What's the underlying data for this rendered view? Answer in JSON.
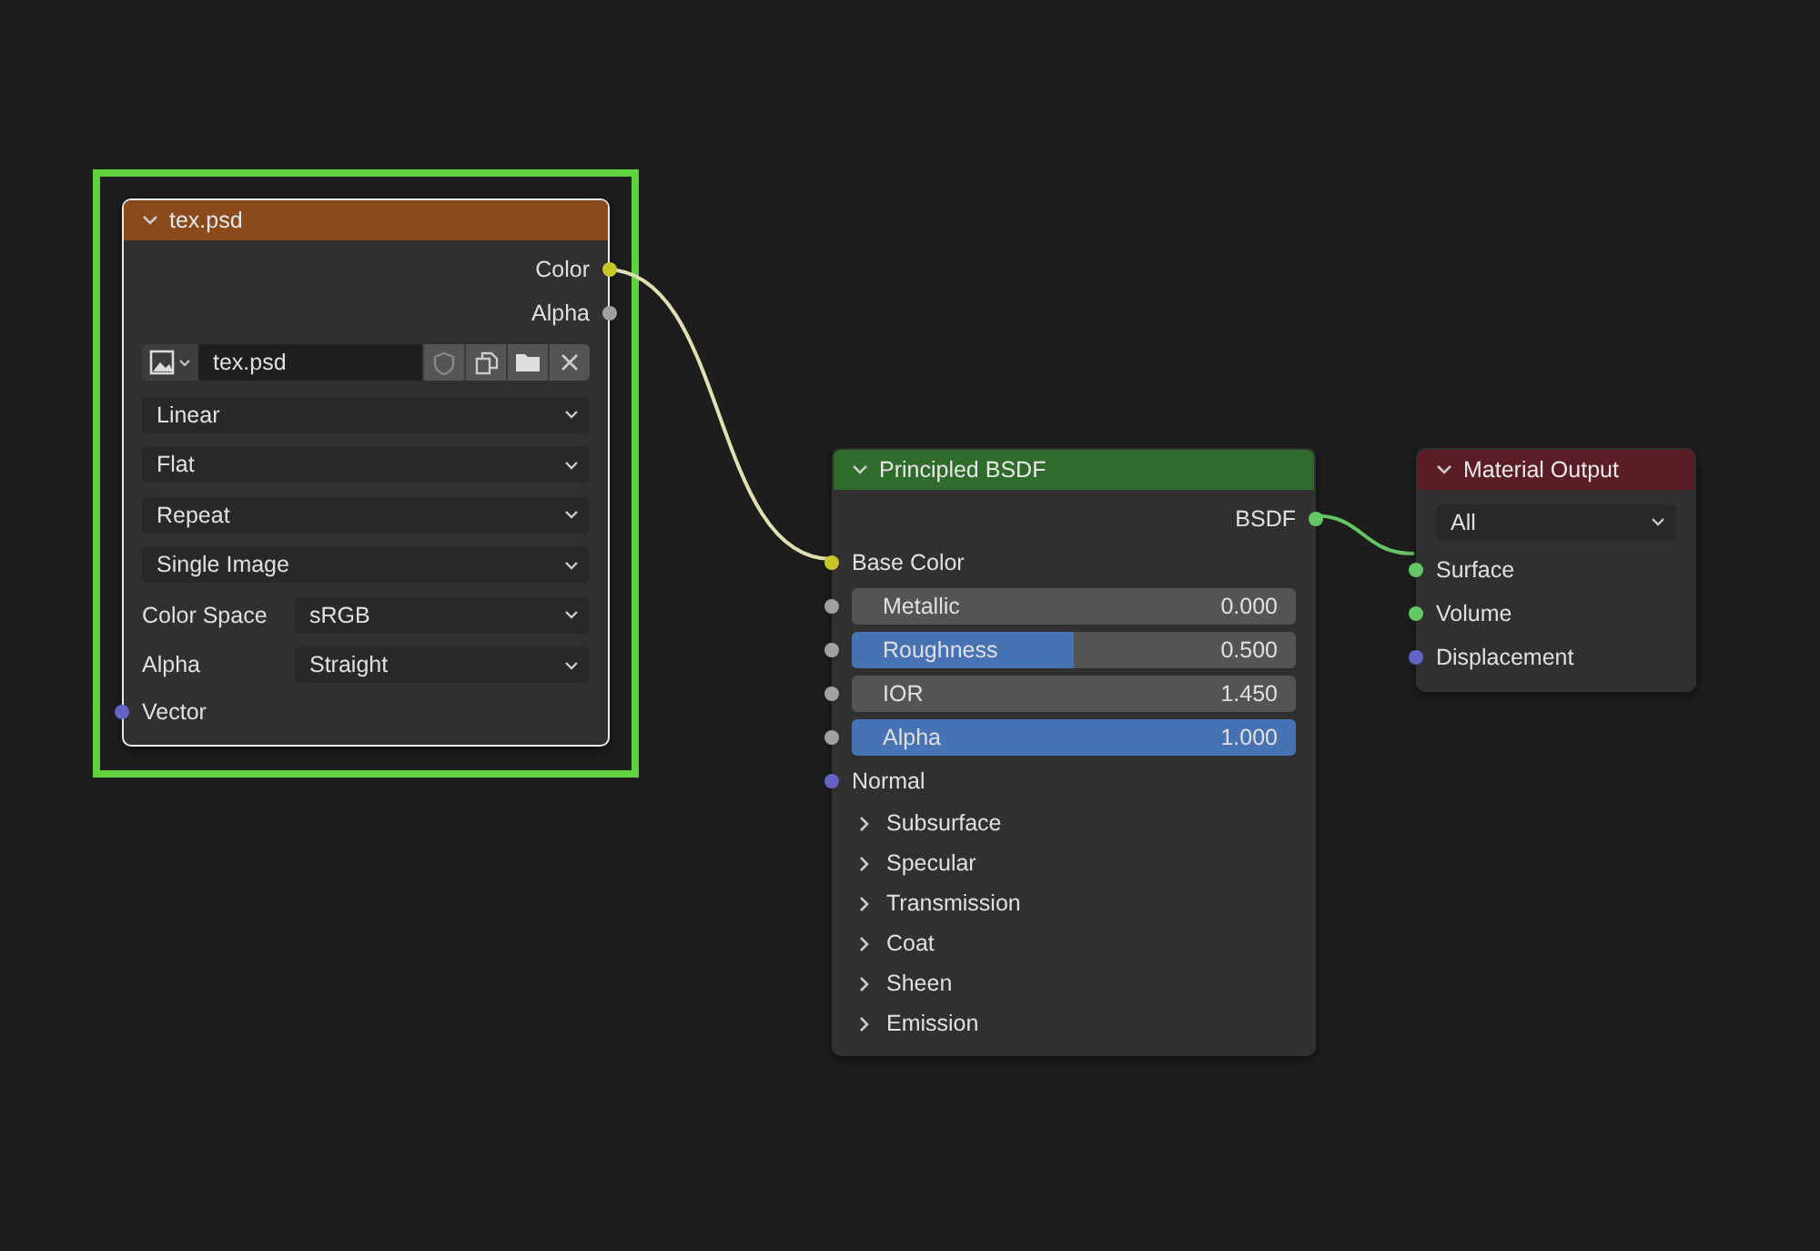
{
  "annotation_frame": true,
  "nodes": [
    {
      "title": "tex.psd",
      "color": "#8a4a1c",
      "selected": true,
      "rows": [
        {
          "kind": "output",
          "label": "Color",
          "color": "#c7c729"
        },
        {
          "kind": "output",
          "label": "Alpha",
          "color": "#a1a1a1"
        },
        {
          "kind": "image",
          "name": "tex.psd"
        },
        {
          "kind": "dropdown",
          "value": "Linear"
        },
        {
          "kind": "dropdown",
          "value": "Flat"
        },
        {
          "kind": "dropdown",
          "value": "Repeat"
        },
        {
          "kind": "dropdown",
          "value": "Single Image"
        },
        {
          "kind": "labeled_dropdown",
          "label": "Color Space",
          "value": "sRGB"
        },
        {
          "kind": "labeled_dropdown",
          "label": "Alpha",
          "value": "Straight"
        },
        {
          "kind": "input",
          "label": "Vector",
          "color": "#6363c7"
        }
      ]
    },
    {
      "title": "Principled BSDF",
      "color": "#2f6b2a",
      "selected": false,
      "rows": [
        {
          "kind": "output",
          "label": "BSDF",
          "color": "#63c763"
        },
        {
          "kind": "input",
          "label": "Base Color",
          "color": "#c7c729"
        },
        {
          "kind": "number",
          "label": "Metallic",
          "value": "0.000",
          "color": "#a1a1a1"
        },
        {
          "kind": "slider",
          "label": "Roughness",
          "value": "0.500",
          "level": 0.5,
          "color": "#a1a1a1"
        },
        {
          "kind": "number",
          "label": "IOR",
          "value": "1.450",
          "color": "#a1a1a1"
        },
        {
          "kind": "slider",
          "label": "Alpha",
          "value": "1.000",
          "level": 1,
          "color": "#a1a1a1"
        },
        {
          "kind": "input",
          "label": "Normal",
          "color": "#6363c7"
        },
        {
          "kind": "panel",
          "label": "Subsurface"
        },
        {
          "kind": "panel",
          "label": "Specular"
        },
        {
          "kind": "panel",
          "label": "Transmission"
        },
        {
          "kind": "panel",
          "label": "Coat"
        },
        {
          "kind": "panel",
          "label": "Sheen"
        },
        {
          "kind": "panel",
          "label": "Emission"
        }
      ]
    },
    {
      "title": "Material Output",
      "color": "#5a1d26",
      "selected": false,
      "rows": [
        {
          "kind": "dropdown",
          "value": "All"
        },
        {
          "kind": "input",
          "label": "Surface",
          "color": "#63c763"
        },
        {
          "kind": "input",
          "label": "Volume",
          "color": "#63c763"
        },
        {
          "kind": "input",
          "label": "Displacement",
          "color": "#6363c7"
        }
      ]
    }
  ]
}
